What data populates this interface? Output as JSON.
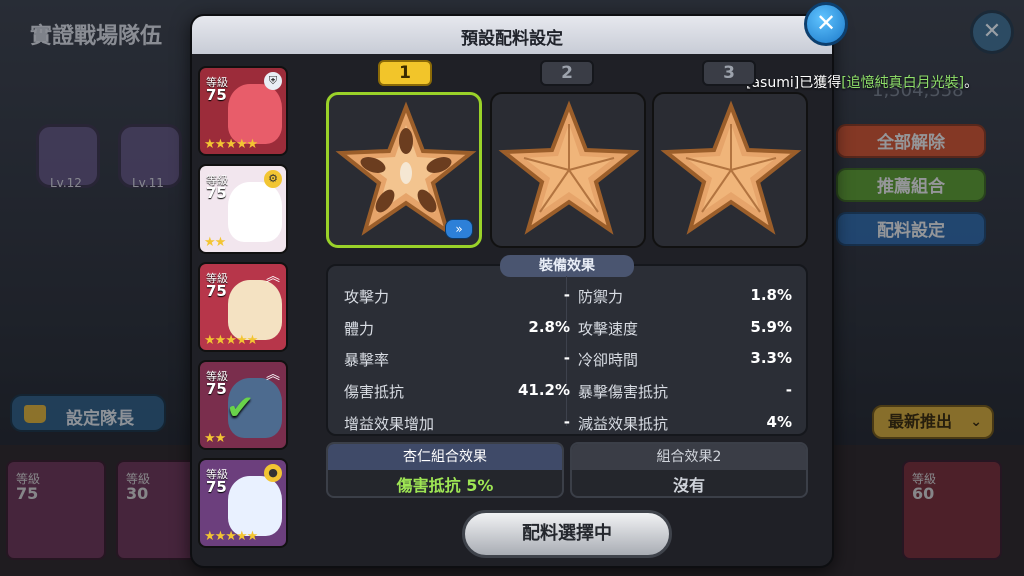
{
  "background": {
    "title": "實證戰場隊伍",
    "badges": [
      {
        "level": "Lv.12"
      },
      {
        "level": "Lv.11"
      }
    ],
    "buttons": [
      {
        "label": "全部解除",
        "color": "#e0562e"
      },
      {
        "label": "推薦組合",
        "color": "#5fa62f"
      },
      {
        "label": "配料設定",
        "color": "#2f6fb4"
      }
    ],
    "leader_button": "設定隊長",
    "sort_button": "最新推出",
    "score": "1,504,558",
    "notification": {
      "prefix": "[asumi]已獲得",
      "highlight": "[追憶純真白月光裝]",
      "suffix": "。"
    },
    "bottom_cards": [
      {
        "level_label": "等級",
        "level": "75"
      },
      {
        "level_label": "等級",
        "level": "30"
      },
      {
        "level_label": "等級",
        "level": "60"
      }
    ]
  },
  "modal": {
    "title": "預設配料設定",
    "cookies": [
      {
        "level_label": "等級",
        "level": "75",
        "stars": "★★★★★",
        "color": "#9c2c3a"
      },
      {
        "level_label": "等級",
        "level": "75",
        "stars": "★★",
        "color": "#f2e6ee"
      },
      {
        "level_label": "等級",
        "level": "75",
        "stars": "★★★★★",
        "color": "#b7364a"
      },
      {
        "level_label": "等級",
        "level": "75",
        "stars": "★★",
        "color": "#7a2e4d"
      },
      {
        "level_label": "等級",
        "level": "75",
        "stars": "★★★★★",
        "color": "#6c3f7d"
      }
    ],
    "slots": [
      {
        "label": "1",
        "active": true
      },
      {
        "label": "2",
        "active": false
      },
      {
        "label": "3",
        "active": false
      }
    ],
    "effects_title": "裝備效果",
    "stats_left": [
      {
        "name": "攻擊力",
        "value": "-"
      },
      {
        "name": "體力",
        "value": "2.8%"
      },
      {
        "name": "暴擊率",
        "value": "-"
      },
      {
        "name": "傷害抵抗",
        "value": "41.2%"
      },
      {
        "name": "增益效果增加",
        "value": "-"
      }
    ],
    "stats_right": [
      {
        "name": "防禦力",
        "value": "1.8%"
      },
      {
        "name": "攻擊速度",
        "value": "5.9%"
      },
      {
        "name": "冷卻時間",
        "value": "3.3%"
      },
      {
        "name": "暴擊傷害抵抗",
        "value": "-"
      },
      {
        "name": "減益效果抵抗",
        "value": "4%"
      }
    ],
    "combo1": {
      "title": "杏仁組合效果",
      "value": "傷害抵抗 5%"
    },
    "combo2": {
      "title": "組合效果2",
      "value": "沒有"
    },
    "select_button": "配料選擇中"
  }
}
